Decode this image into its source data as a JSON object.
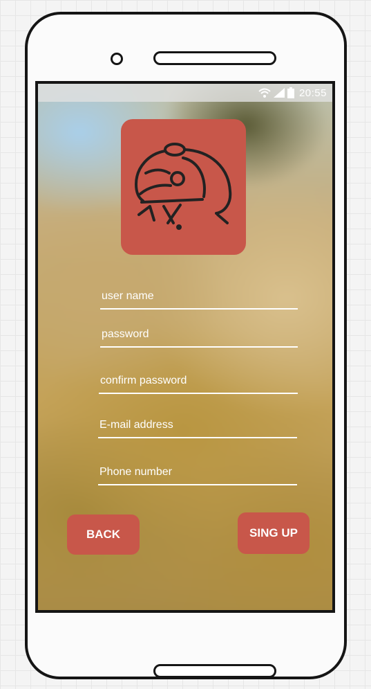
{
  "status_bar": {
    "time": "20:55",
    "icons": [
      "wifi-icon",
      "signal-icon",
      "battery-icon"
    ]
  },
  "logo": {
    "icon": "mascot-logo-icon",
    "color": "#c8574a"
  },
  "form": {
    "username": {
      "value": "",
      "placeholder": "user name"
    },
    "password": {
      "value": "",
      "placeholder": "password"
    },
    "confirm_password": {
      "value": "",
      "placeholder": "confirm password"
    },
    "email": {
      "value": "",
      "placeholder": "E-mail address"
    },
    "phone": {
      "value": "",
      "placeholder": "Phone number"
    }
  },
  "buttons": {
    "back_label": "BACK",
    "signup_label": "SING UP",
    "color": "#c8574a"
  }
}
